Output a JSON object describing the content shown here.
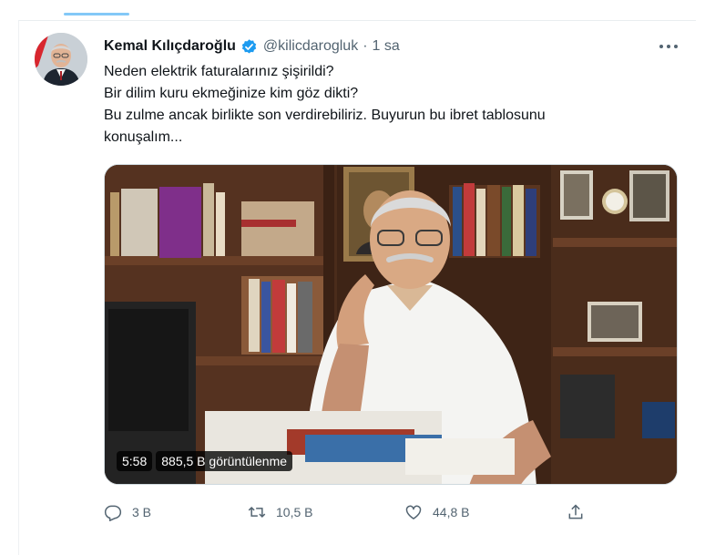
{
  "tweet": {
    "author": {
      "display_name": "Kemal Kılıçdaroğlu",
      "handle": "@kilicdarogluk",
      "separator": "·",
      "time": "1 sa"
    },
    "text_lines": [
      "Neden elektrik faturalarınız şişirildi?",
      "Bir dilim kuru ekmeğinize kim göz dikti?",
      "Bu zulme ancak birlikte son verdirebiliriz. Buyurun bu ibret tablosunu",
      "konuşalım..."
    ],
    "media": {
      "duration": "5:58",
      "views": "885,5 B görüntülenme"
    },
    "actions": {
      "replies": "3 B",
      "retweets": "10,5 B",
      "likes": "44,8 B"
    }
  },
  "colors": {
    "accent": "#1d9bf0",
    "secondary_text": "#536471",
    "primary_text": "#0f1419"
  },
  "icons": {
    "more": "more-dots-icon",
    "verified": "verified-badge-icon",
    "reply": "reply-icon",
    "retweet": "retweet-icon",
    "like": "heart-icon",
    "share": "share-icon"
  }
}
